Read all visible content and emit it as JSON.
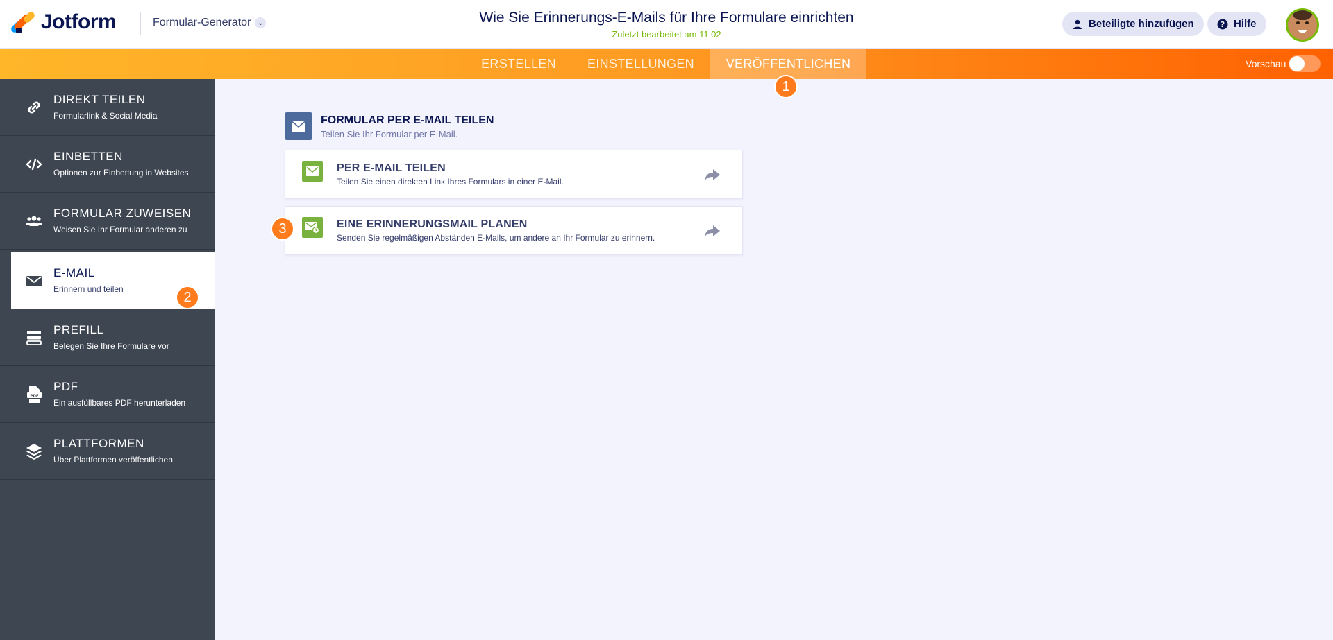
{
  "header": {
    "brand": "Jotform",
    "generator": "Formular-Generator",
    "title": "Wie Sie Erinnerungs-E-Mails für Ihre Formulare einrichten",
    "subtitle": "Zuletzt bearbeitet am 11:02",
    "add_participants": "Beteiligte hinzufügen",
    "help": "Hilfe"
  },
  "nav": {
    "tabs": [
      {
        "label": "ERSTELLEN",
        "active": false
      },
      {
        "label": "EINSTELLUNGEN",
        "active": false
      },
      {
        "label": "VERÖFFENTLICHEN",
        "active": true
      }
    ],
    "preview_label": "Vorschau",
    "preview_on": false
  },
  "sidebar": {
    "items": [
      {
        "title": "DIREKT TEILEN",
        "subtitle": "Formularlink & Social Media",
        "icon": "link-icon"
      },
      {
        "title": "EINBETTEN",
        "subtitle": "Optionen zur Einbettung in Websites",
        "icon": "code-icon"
      },
      {
        "title": "FORMULAR ZUWEISEN",
        "subtitle": "Weisen Sie Ihr Formular anderen zu",
        "icon": "users-icon"
      },
      {
        "title": "E-MAIL",
        "subtitle": "Erinnern und teilen",
        "icon": "envelope-icon",
        "active": true
      },
      {
        "title": "PREFILL",
        "subtitle": "Belegen Sie Ihre Formulare vor",
        "icon": "prefill-icon"
      },
      {
        "title": "PDF",
        "subtitle": "Ein ausfüllbares PDF herunterladen",
        "icon": "pdf-icon"
      },
      {
        "title": "PLATTFORMEN",
        "subtitle": "Über Plattformen veröffentlichen",
        "icon": "layers-icon"
      }
    ]
  },
  "main": {
    "section_title": "FORMULAR PER E-MAIL TEILEN",
    "section_subtitle": "Teilen Sie Ihr Formular per E-Mail.",
    "cards": [
      {
        "title": "PER E-MAIL TEILEN",
        "subtitle": "Teilen Sie einen direkten Link Ihres Formulars in einer E-Mail."
      },
      {
        "title": "EINE ERINNERUNGSMAIL PLANEN",
        "subtitle": "Senden Sie regelmäßigen Abständen E-Mails, um andere an Ihr Formular zu erinnern."
      }
    ]
  },
  "steps": [
    "1",
    "2",
    "3"
  ],
  "colors": {
    "accent_orange": "#ff6100",
    "step_badge": "#ff7b1c",
    "sidebar_bg": "#3e4652",
    "card_icon_green": "#7ab23f",
    "subtitle_green": "#78bb07"
  }
}
